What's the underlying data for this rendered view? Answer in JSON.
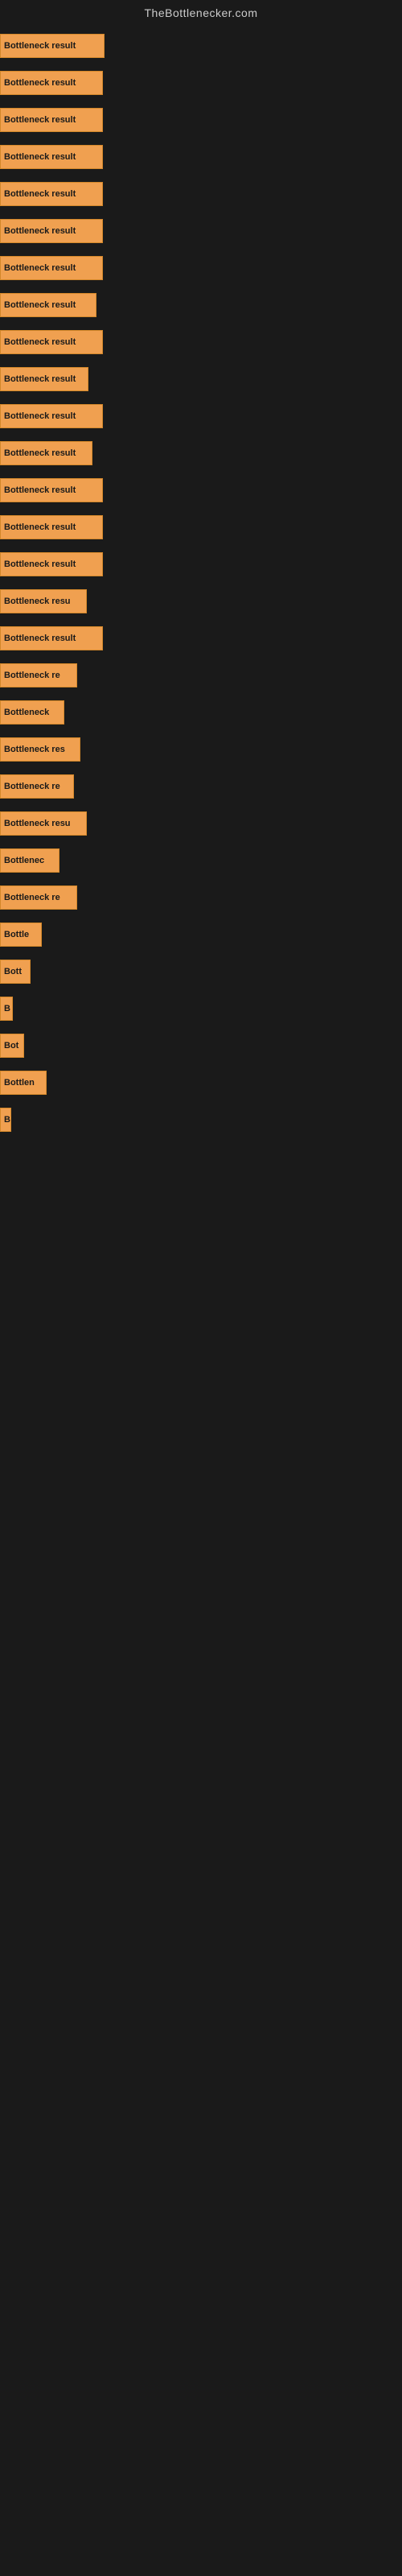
{
  "site": {
    "title": "TheBottlenecker.com"
  },
  "bars": [
    {
      "label": "Bottleneck result",
      "width": 130
    },
    {
      "label": "Bottleneck result",
      "width": 128
    },
    {
      "label": "Bottleneck result",
      "width": 128
    },
    {
      "label": "Bottleneck result",
      "width": 128
    },
    {
      "label": "Bottleneck result",
      "width": 128
    },
    {
      "label": "Bottleneck result",
      "width": 128
    },
    {
      "label": "Bottleneck result",
      "width": 128
    },
    {
      "label": "Bottleneck result",
      "width": 120
    },
    {
      "label": "Bottleneck result",
      "width": 128
    },
    {
      "label": "Bottleneck result",
      "width": 110
    },
    {
      "label": "Bottleneck result",
      "width": 128
    },
    {
      "label": "Bottleneck result",
      "width": 115
    },
    {
      "label": "Bottleneck result",
      "width": 128
    },
    {
      "label": "Bottleneck result",
      "width": 128
    },
    {
      "label": "Bottleneck result",
      "width": 128
    },
    {
      "label": "Bottleneck resu",
      "width": 108
    },
    {
      "label": "Bottleneck result",
      "width": 128
    },
    {
      "label": "Bottleneck re",
      "width": 96
    },
    {
      "label": "Bottleneck",
      "width": 80
    },
    {
      "label": "Bottleneck res",
      "width": 100
    },
    {
      "label": "Bottleneck re",
      "width": 92
    },
    {
      "label": "Bottleneck resu",
      "width": 108
    },
    {
      "label": "Bottlenec",
      "width": 74
    },
    {
      "label": "Bottleneck re",
      "width": 96
    },
    {
      "label": "Bottle",
      "width": 52
    },
    {
      "label": "Bott",
      "width": 38
    },
    {
      "label": "B",
      "width": 16
    },
    {
      "label": "Bot",
      "width": 30
    },
    {
      "label": "Bottlen",
      "width": 58
    },
    {
      "label": "B",
      "width": 14
    }
  ]
}
